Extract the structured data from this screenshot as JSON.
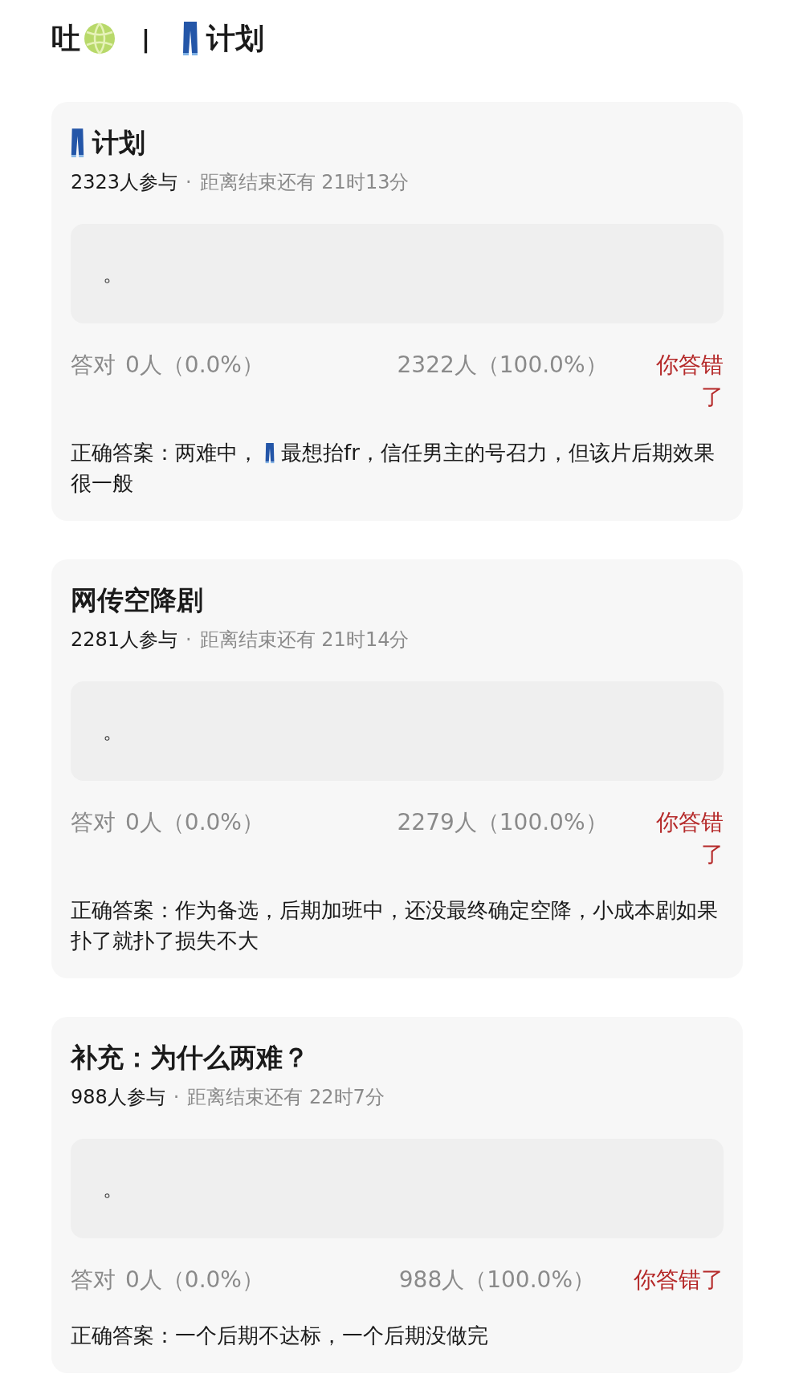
{
  "header": {
    "left": "吐",
    "separator": "|",
    "right": "计划"
  },
  "cards": [
    {
      "title": "计划",
      "has_icon": true,
      "participants": "2323人参与",
      "dot": "·",
      "countdown": "距离结束还有 21时13分",
      "option": "。",
      "correct_label": "答对",
      "correct_count": "0人（0.0%）",
      "wrong_count": "2322人（100.0%）",
      "result": "你答错了",
      "correct": false,
      "answer": {
        "before": "正确答案：两难中，",
        "after": "最想抬fr，信任男主的号召力，但该片后期效果很一般"
      }
    },
    {
      "title": "网传空降剧",
      "has_icon": false,
      "participants": "2281人参与",
      "dot": "·",
      "countdown": "距离结束还有 21时14分",
      "option": "。",
      "correct_label": "答对",
      "correct_count": "0人（0.0%）",
      "wrong_count": "2279人（100.0%）",
      "result": "你答错了",
      "correct": false,
      "answer": {
        "before": "正确答案：作为备选，后期加班中，还没最终确定空降，小成本剧如果扑了就扑了损失不大"
      }
    },
    {
      "title": "补充：为什么两难？",
      "has_icon": false,
      "participants": "988人参与",
      "dot": "·",
      "countdown": "距离结束还有 22时7分",
      "option": "。",
      "correct_label": "答对",
      "correct_count": "0人（0.0%）",
      "wrong_count": "988人（100.0%）",
      "result": "你答错了",
      "correct": false,
      "answer": {
        "before": "正确答案：一个后期不达标，一个后期没做完"
      }
    }
  ]
}
